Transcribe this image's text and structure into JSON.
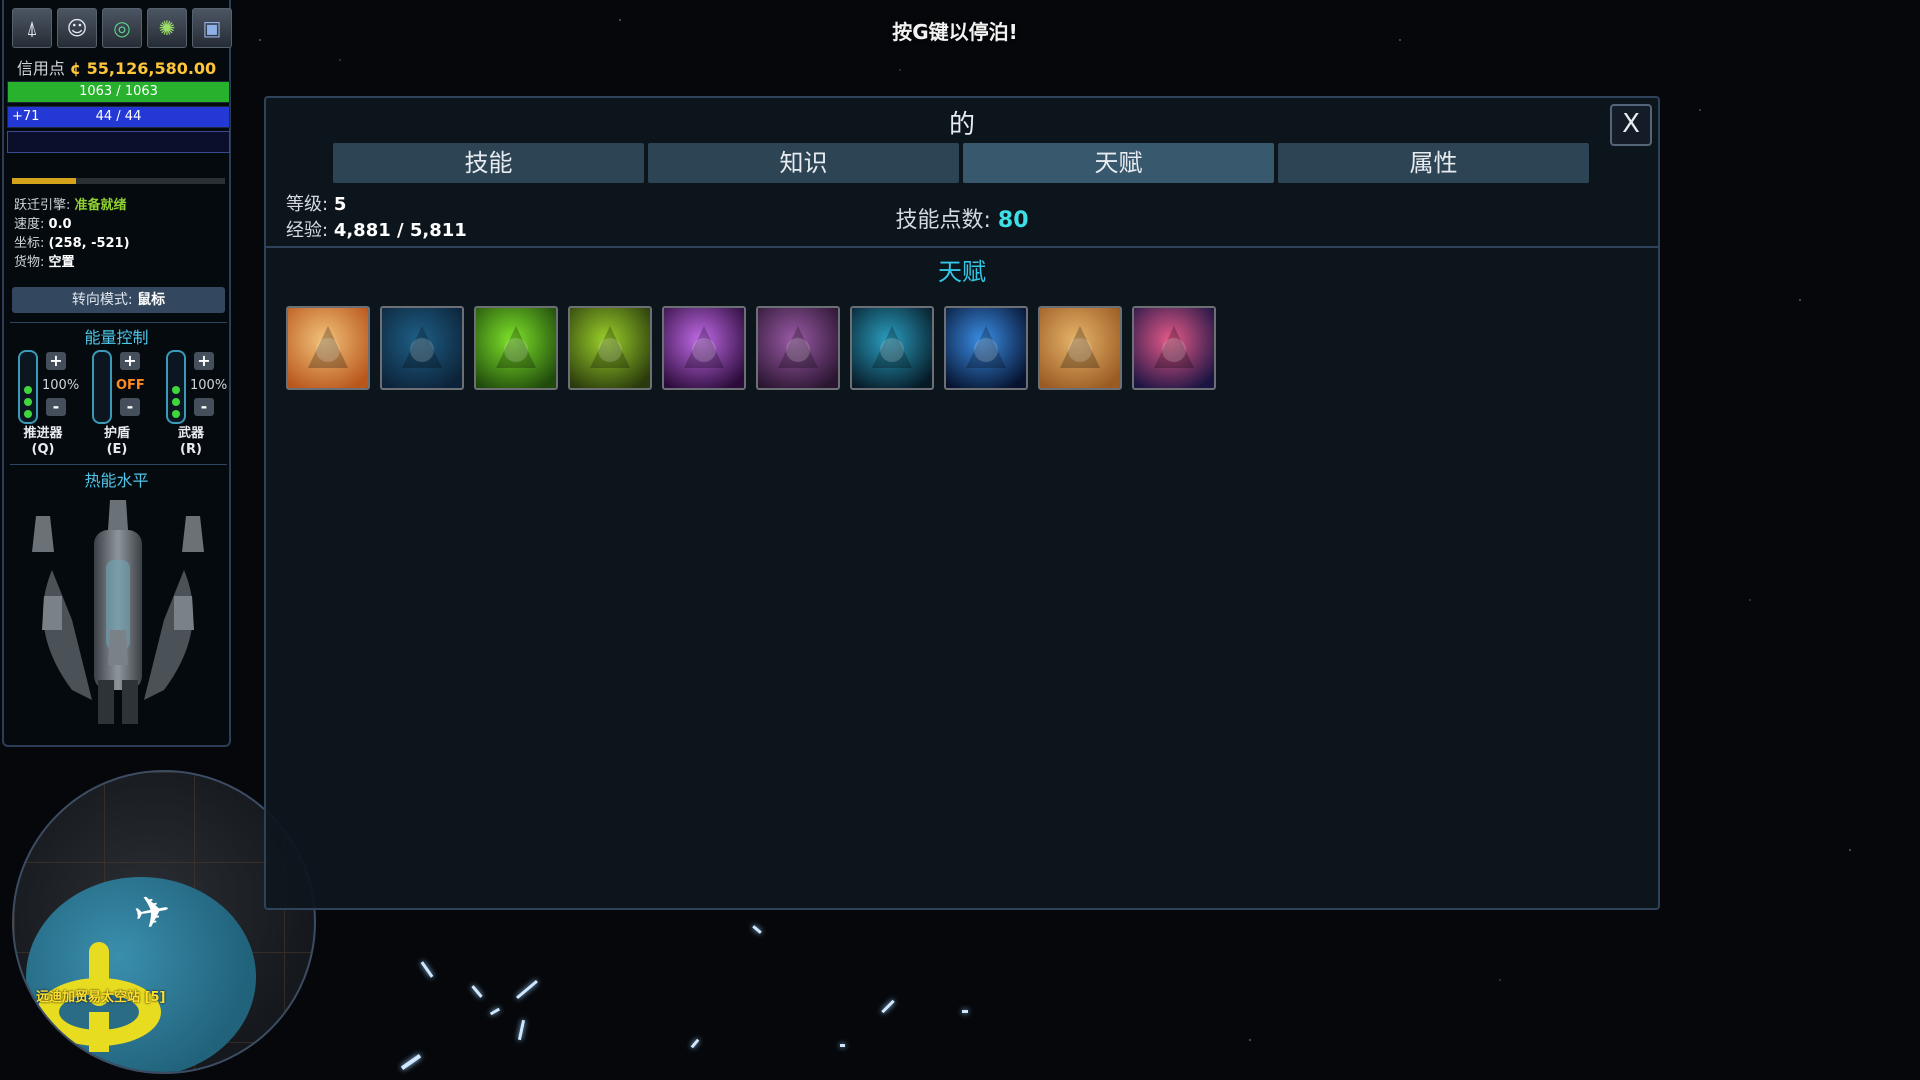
{
  "hud": {
    "icons": [
      {
        "name": "ship-icon",
        "glyph": "⍋"
      },
      {
        "name": "pilot-icon",
        "glyph": "☺"
      },
      {
        "name": "radar-icon",
        "glyph": "◎"
      },
      {
        "name": "galaxy-map-icon",
        "glyph": "✺"
      },
      {
        "name": "codex-icon",
        "glyph": "▣"
      }
    ],
    "credits_label": "信用点",
    "credits_value": "¢ 55,126,580.00",
    "hull": {
      "text": "1063 / 1063",
      "fraction": 1.0,
      "color": "#27b12d"
    },
    "shield": {
      "text": "44 / 44",
      "bonus": "+71",
      "fraction": 1.0,
      "color": "#2438d6"
    },
    "energy": {
      "fraction": 0.0,
      "color": "#1a2a88"
    },
    "jump_progress": 0.3,
    "status": {
      "jump_label": "跃迁引擎:",
      "jump_value": "准备就绪",
      "speed_label": "速度:",
      "speed_value": "0.0",
      "coords_label": "坐标:",
      "coords_value": "(258, -521)",
      "cargo_label": "货物:",
      "cargo_value": "空置"
    },
    "steer_label": "转向模式:",
    "steer_value": "鼠标",
    "power_title": "能量控制",
    "power": [
      {
        "name": "推进器",
        "key": "(Q)",
        "value": "100%",
        "level": 3
      },
      {
        "name": "护盾",
        "key": "(E)",
        "value": "OFF",
        "level": 0
      },
      {
        "name": "武器",
        "key": "(R)",
        "value": "100%",
        "level": 3
      }
    ],
    "plus": "+",
    "minus": "-",
    "heat_title": "热能水平"
  },
  "minimap": {
    "station_label": "远迪加贸易太空站 [5]"
  },
  "dock_hint": "按G键以停泊!",
  "dialog": {
    "title": "的",
    "close": "X",
    "tabs": [
      "技能",
      "知识",
      "天赋",
      "属性"
    ],
    "active_tab": 2,
    "level_label": "等级:",
    "level_value": "5",
    "xp_label": "经验:",
    "xp_value": "4,881 / 5,811",
    "skill_points_label": "技能点数:",
    "skill_points_value": "80",
    "content_title": "天赋",
    "talents": [
      {
        "name": "talent-pirate-icon",
        "colors": [
          "#f2c27a",
          "#b8561c"
        ]
      },
      {
        "name": "talent-wings-icon",
        "colors": [
          "#1e5f86",
          "#0c2238"
        ]
      },
      {
        "name": "talent-green-beam-icon",
        "colors": [
          "#7ee32a",
          "#1f4a0c"
        ]
      },
      {
        "name": "talent-wasp-icon",
        "colors": [
          "#9ad02a",
          "#2a3a0c"
        ]
      },
      {
        "name": "talent-purple-strike-icon",
        "colors": [
          "#c06ae6",
          "#2b0b3a"
        ]
      },
      {
        "name": "talent-armor-blocks-icon",
        "colors": [
          "#9a5aa6",
          "#2a1530"
        ]
      },
      {
        "name": "talent-particles-icon",
        "colors": [
          "#2a9ec0",
          "#061a26"
        ]
      },
      {
        "name": "talent-vortex-icon",
        "colors": [
          "#3a8ee6",
          "#06122e"
        ]
      },
      {
        "name": "talent-star-map-icon",
        "colors": [
          "#e6b46a",
          "#9a5a22"
        ]
      },
      {
        "name": "talent-fighter-icon",
        "colors": [
          "#e65a8a",
          "#1a1442"
        ]
      }
    ]
  }
}
